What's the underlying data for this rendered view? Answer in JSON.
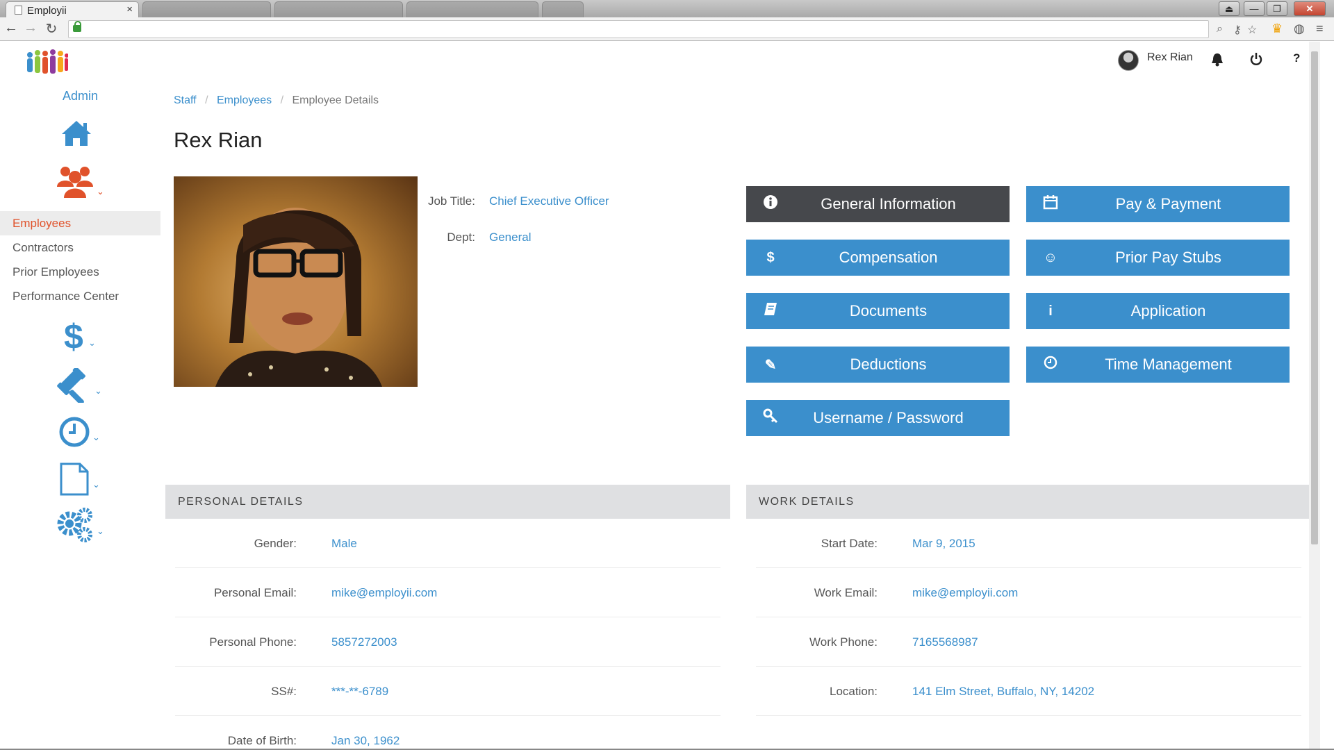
{
  "browser": {
    "active_tab_title": "Employii",
    "tab_close": "×",
    "win_min": "—",
    "win_max": "❐",
    "win_close": "✕",
    "back": "←",
    "forward": "→",
    "reload": "↻"
  },
  "sidebar": {
    "admin_label": "Admin",
    "nav_items": [
      {
        "label": "Employees",
        "active": true
      },
      {
        "label": "Contractors",
        "active": false
      },
      {
        "label": "Prior Employees",
        "active": false
      },
      {
        "label": "Performance Center",
        "active": false
      }
    ],
    "icons": [
      "home-icon",
      "people-icon",
      "dollar-icon",
      "gavel-icon",
      "clock-icon",
      "document-icon",
      "gears-icon"
    ],
    "colors": {
      "accent": "#3b8fcc",
      "active": "#e0522b"
    }
  },
  "header": {
    "user_name": "Rex Rian",
    "icons": [
      "avatar",
      "bell-icon",
      "power-icon",
      "help-icon"
    ],
    "help_glyph": "?"
  },
  "breadcrumb": {
    "items": [
      "Staff",
      "Employees",
      "Employee Details"
    ],
    "separator": "/"
  },
  "employee": {
    "name": "Rex Rian",
    "job_title_label": "Job Title:",
    "job_title": "Chief Executive Officer",
    "dept_label": "Dept:",
    "dept": "General"
  },
  "actions": [
    {
      "label": "General Information",
      "icon": "info-circle-icon",
      "glyph": "i",
      "active": true
    },
    {
      "label": "Pay & Payment",
      "icon": "calendar-icon",
      "glyph": "▦",
      "active": false
    },
    {
      "label": "Compensation",
      "icon": "dollar-icon",
      "glyph": "$",
      "active": false
    },
    {
      "label": "Prior Pay Stubs",
      "icon": "smiley-icon",
      "glyph": "☺",
      "active": false
    },
    {
      "label": "Documents",
      "icon": "book-icon",
      "glyph": "▤",
      "active": false
    },
    {
      "label": "Application",
      "icon": "info-icon",
      "glyph": "i",
      "active": false
    },
    {
      "label": "Deductions",
      "icon": "pencil-icon",
      "glyph": "✎",
      "active": false
    },
    {
      "label": "Time Management",
      "icon": "clock-icon",
      "glyph": "◷",
      "active": false
    },
    {
      "label": "Username / Password",
      "icon": "key-icon",
      "glyph": "⚷",
      "active": false
    }
  ],
  "personal_details": {
    "title": "PERSONAL DETAILS",
    "rows": [
      {
        "label": "Gender:",
        "value": "Male"
      },
      {
        "label": "Personal Email:",
        "value": "mike@employii.com"
      },
      {
        "label": "Personal Phone:",
        "value": "5857272003"
      },
      {
        "label": "SS#:",
        "value": "***-**-6789"
      },
      {
        "label": "Date of Birth:",
        "value": "Jan 30, 1962"
      }
    ]
  },
  "work_details": {
    "title": "WORK DETAILS",
    "rows": [
      {
        "label": "Start Date:",
        "value": "Mar 9, 2015"
      },
      {
        "label": "Work Email:",
        "value": "mike@employii.com"
      },
      {
        "label": "Work Phone:",
        "value": "7165568987"
      },
      {
        "label": "Location:",
        "value": "141 Elm Street, Buffalo, NY, 14202"
      }
    ]
  }
}
